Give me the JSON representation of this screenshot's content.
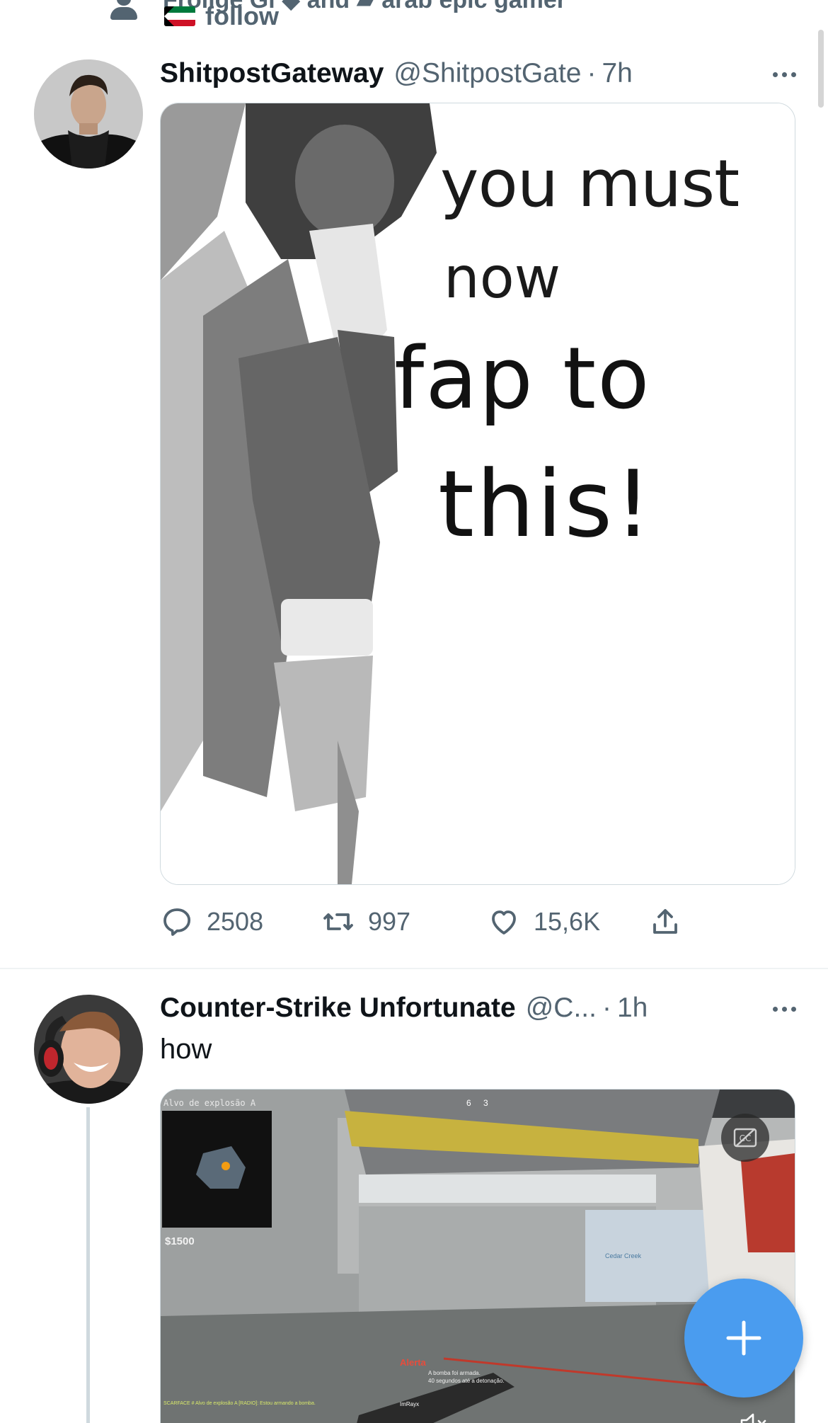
{
  "social_context": {
    "line1": "Frolige Gi ◆ and ▰ arab epic gamer",
    "line2": "follow"
  },
  "tweets": [
    {
      "name": "ShitpostGateway",
      "handle": "@ShitpostGate",
      "dot": "·",
      "time": "7h",
      "meme_lines": [
        "you must",
        "now",
        "fap to",
        "this!"
      ],
      "stats": {
        "replies": "2508",
        "retweets": "997",
        "likes": "15,6K"
      }
    },
    {
      "name": "Counter-Strike Unfortunate",
      "handle": "@C...",
      "dot": "·",
      "time": "1h",
      "text": "how",
      "hud": {
        "target": "Alvo de explosão A",
        "money": "$1500",
        "score_left": "6",
        "score_right": "3",
        "alert": "Alerta",
        "bomb_line1": "A bomba foi armada.",
        "bomb_line2": "40 segundos até a detonação.",
        "chat": "SCARFACE # Alvo de explosão A [RADIO]: Estou armando a bomba.",
        "player": "ImRayx",
        "sign": "Cedar Creek"
      }
    }
  ],
  "colors": {
    "text_primary": "#0f1419",
    "text_secondary": "#536471",
    "fab_blue": "#4a9cef",
    "divider": "#eff3f4"
  },
  "icons": [
    "person-icon",
    "kuwait-flag-icon",
    "more-icon",
    "reply-icon",
    "retweet-icon",
    "like-icon",
    "share-icon",
    "closed-captions-icon",
    "muted-icon",
    "compose-plus-icon"
  ]
}
